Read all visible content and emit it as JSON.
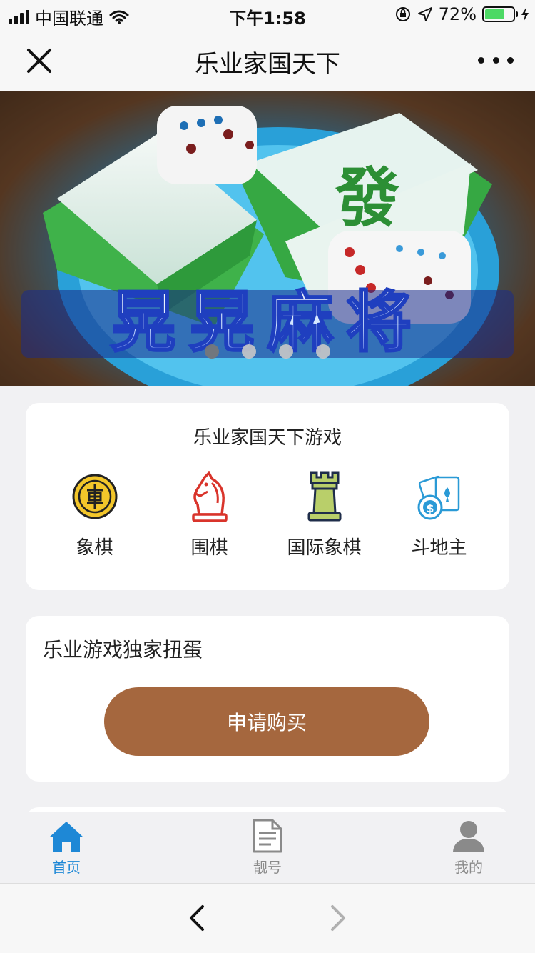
{
  "status_bar": {
    "carrier": "中国联通",
    "time": "下午1:58",
    "battery_percent": "72%",
    "battery_level": 0.72
  },
  "nav": {
    "title": "乐业家国天下",
    "close_icon": "close-icon",
    "more_icon": "more-icon"
  },
  "banner": {
    "slide_count": 4,
    "active_index": 0,
    "image_text": "晃晃麻将"
  },
  "games_card": {
    "title": "乐业家国天下游戏",
    "items": [
      {
        "label": "象棋",
        "icon": "chinese-chess-icon"
      },
      {
        "label": "围棋",
        "icon": "knight-icon"
      },
      {
        "label": "国际象棋",
        "icon": "rook-icon"
      },
      {
        "label": "斗地主",
        "icon": "cards-icon"
      }
    ]
  },
  "gacha_card": {
    "title": "乐业游戏独家扭蛋",
    "button_label": "申请购买",
    "button_color": "#a5673e"
  },
  "tab_bar": {
    "items": [
      {
        "label": "首页",
        "icon": "home-icon",
        "active": true
      },
      {
        "label": "靓号",
        "icon": "document-icon",
        "active": false
      },
      {
        "label": "我的",
        "icon": "user-icon",
        "active": false
      }
    ],
    "active_color": "#1e88d6",
    "inactive_color": "#8a8a8a"
  },
  "browser_bar": {
    "back_icon": "chevron-left-icon",
    "forward_icon": "chevron-right-icon"
  }
}
